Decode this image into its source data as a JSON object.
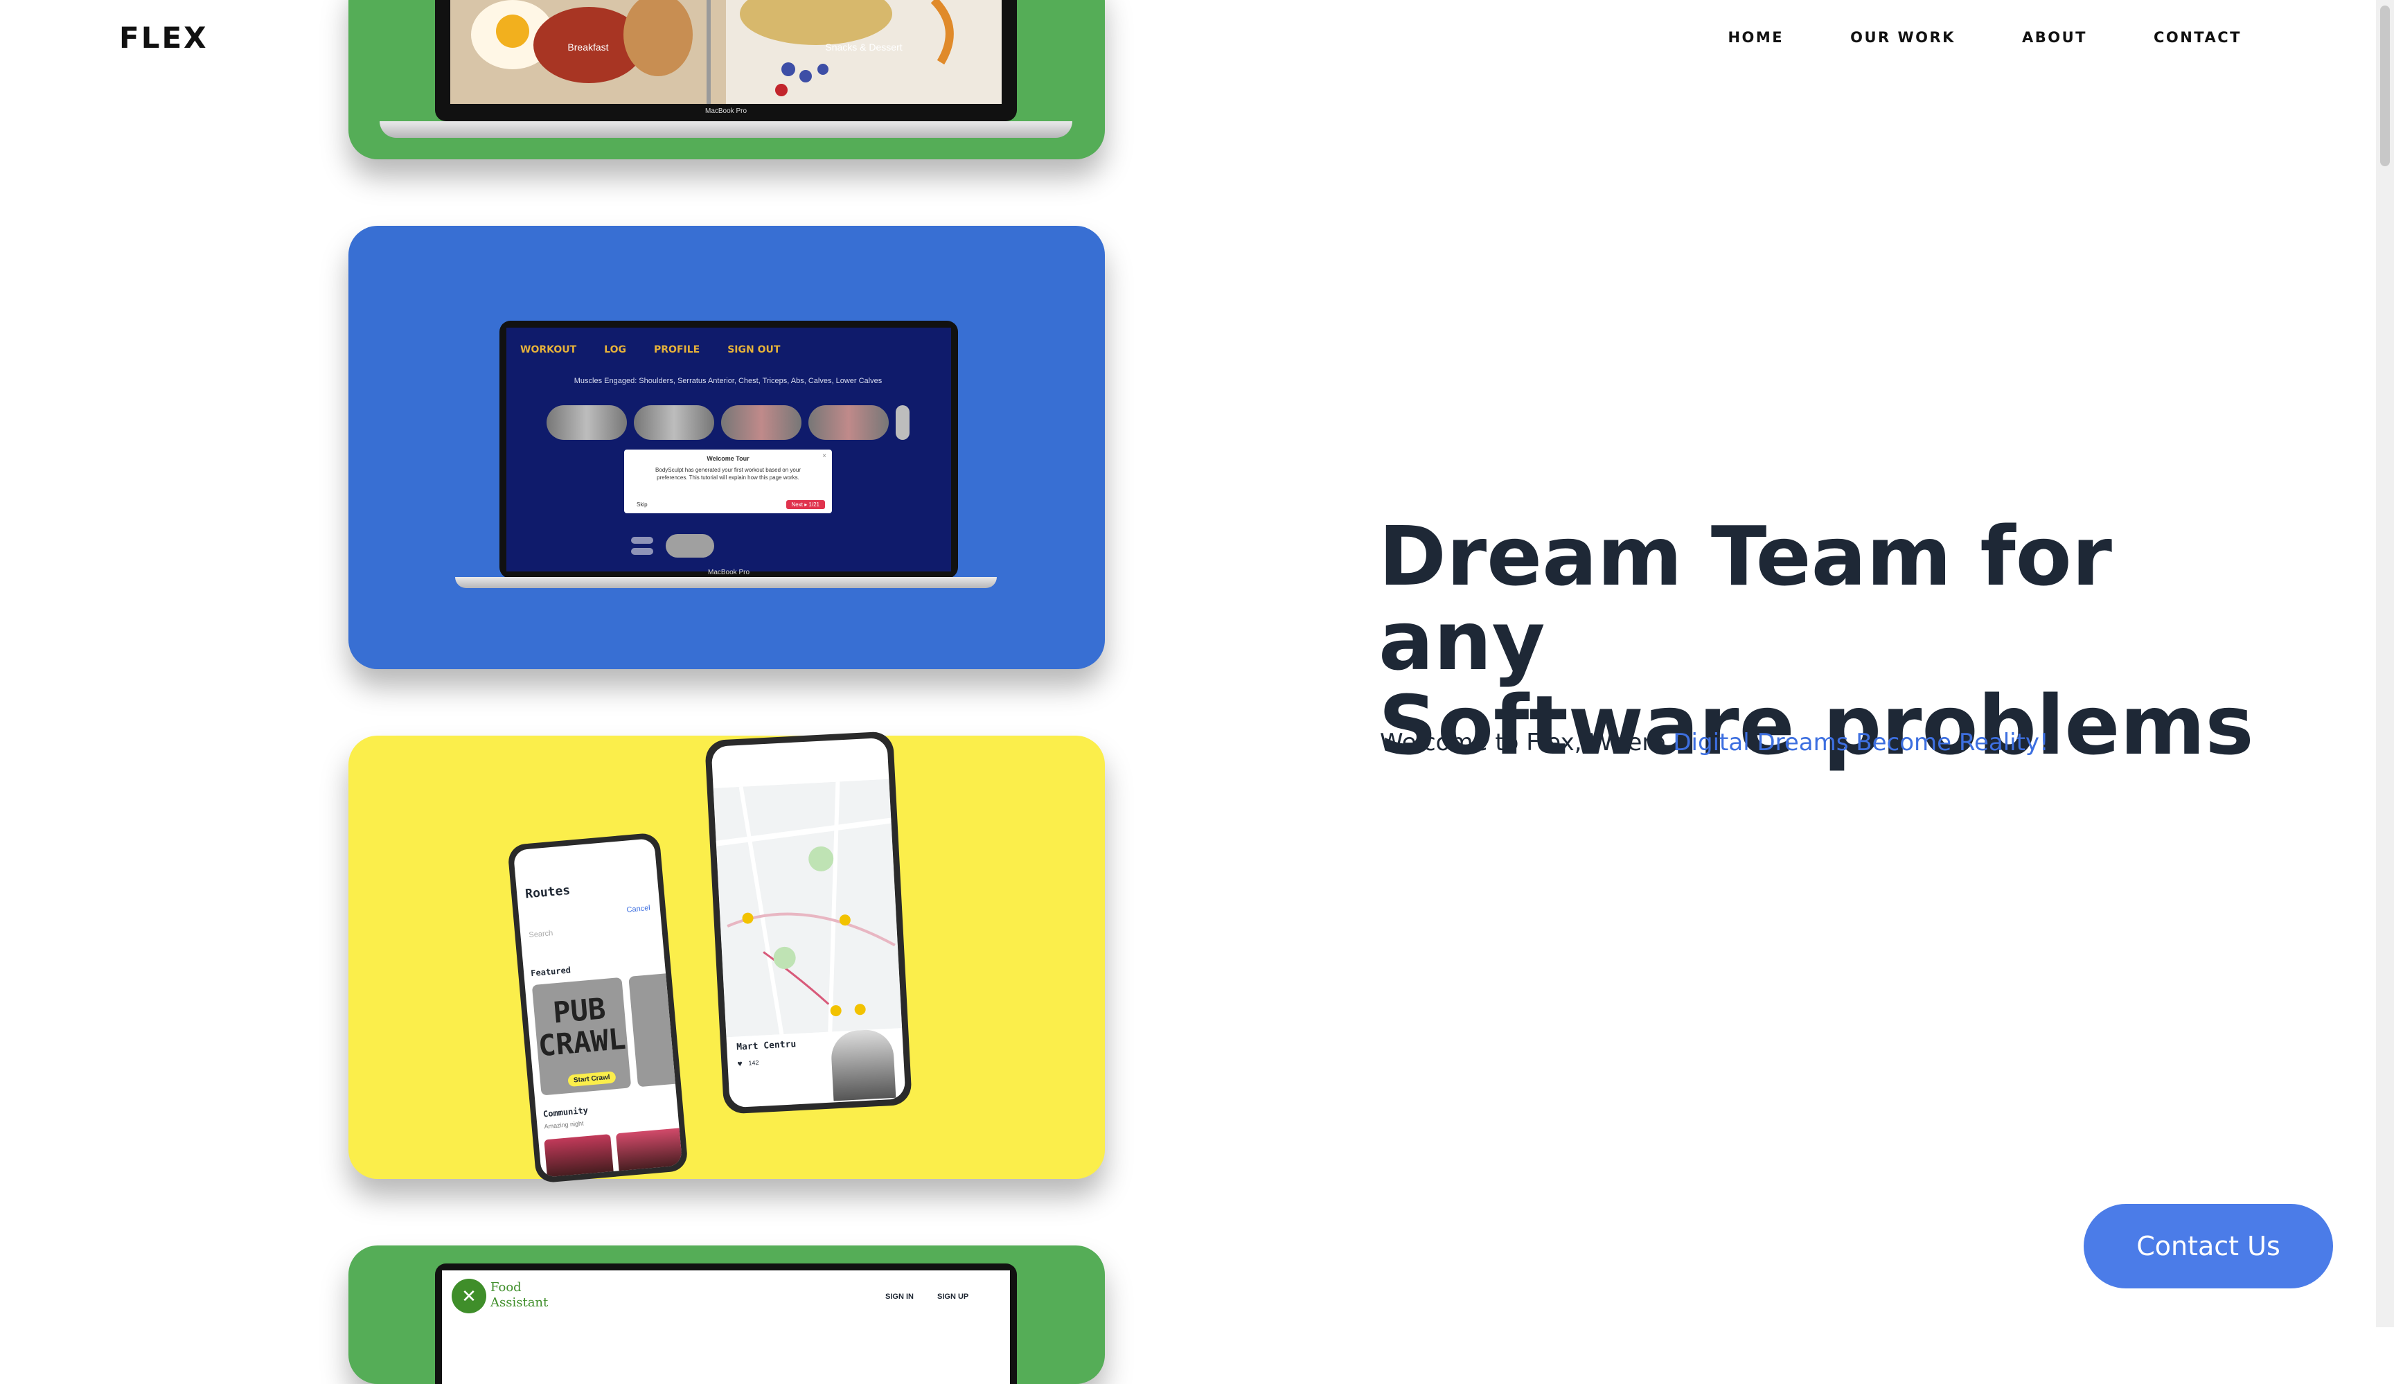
{
  "header": {
    "brand": "FLEX",
    "nav": [
      "HOME",
      "OUR WORK",
      "ABOUT",
      "CONTACT"
    ]
  },
  "hero": {
    "title_line1": "Dream Team for any",
    "title_line2": "Software problems",
    "subtitle_prefix": "Welcome to Flex, Where ",
    "subtitle_highlight": "Digital Dreams Become Reality!",
    "highlight_color": "#3d6fe0"
  },
  "cta": {
    "label": "Contact Us",
    "color": "#4b7ce8"
  },
  "cards": {
    "food_top": {
      "bg_color": "#55ad57",
      "tile_left": "Breakfast",
      "tile_right": "Snacks & Dessert",
      "laptop_label": "MacBook Pro"
    },
    "workout": {
      "bg_color": "#386fd3",
      "nav_items": [
        "WORKOUT",
        "LOG",
        "PROFILE",
        "SIGN OUT"
      ],
      "muscles_text": "Muscles Engaged: Shoulders, Serratus Anterior, Chest, Triceps, Abs, Calves, Lower Calves",
      "dialog_title": "Welcome Tour",
      "dialog_body": "BodySculpt has generated your first workout based on your preferences. This tutorial will explain how this page works.",
      "dialog_skip": "Skip",
      "dialog_next": "Next ▸ 1/21",
      "laptop_label": "MacBook Pro"
    },
    "routes": {
      "bg_color": "#fbee4b",
      "left_title": "Routes",
      "left_search": "Search",
      "left_cancel": "Cancel",
      "left_featured": "Featured",
      "left_tile_text": "PUB CRAWL",
      "left_button": "Start Crawl",
      "left_community": "Community",
      "left_community_sub": "Amazing night",
      "right_place": "Mart Centru",
      "right_likes": "142"
    },
    "food_bottom": {
      "bg_color": "#55ad57",
      "brand_line1": "Food",
      "brand_line2": "Assistant",
      "sign_in": "SIGN IN",
      "sign_up": "SIGN UP"
    }
  }
}
